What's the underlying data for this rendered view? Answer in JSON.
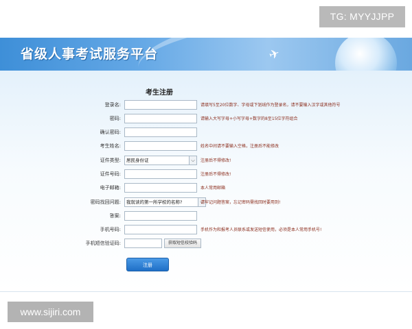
{
  "watermark_top": "TG: MYYJJPP",
  "watermark_bottom": "www.sijiri.com",
  "banner": {
    "title": "省级人事考试服务平台"
  },
  "form": {
    "title": "考生注册",
    "fields": [
      {
        "label": "登录名:",
        "value": "",
        "hint": "请填写5至20位数字、字母或下划线作为登录名，请不要输入汉字或其他符号"
      },
      {
        "label": "密码:",
        "value": "",
        "hint": "请输入大写字母+小写字母+数字的8至15位字符组合"
      },
      {
        "label": "确认密码:",
        "value": "",
        "hint": ""
      },
      {
        "label": "考生姓名:",
        "value": "",
        "hint": "姓名中间请不要输入空格，注册后不能修改"
      },
      {
        "label": "证件类型:",
        "value": "居民身份证",
        "hint": "注册后不得修改!"
      },
      {
        "label": "证件号码:",
        "value": "",
        "hint": "注册后不得修改!"
      },
      {
        "label": "电子邮箱:",
        "value": "",
        "hint": "本人常用邮箱"
      },
      {
        "label": "密码找回问题:",
        "value": "我就读的第一所学校的名称?",
        "hint": "请牢记问题答案，忘记密码需找回时要用到!"
      },
      {
        "label": "答案:",
        "value": "",
        "hint": ""
      },
      {
        "label": "手机号码:",
        "value": "",
        "hint": "手机作为和报考人员联系或发送短信使用，必须是本人常用手机号!"
      },
      {
        "label": "手机短信验证码:",
        "value": "",
        "hint": ""
      }
    ],
    "sms_button": "获取短信校验码",
    "submit": "注册"
  }
}
